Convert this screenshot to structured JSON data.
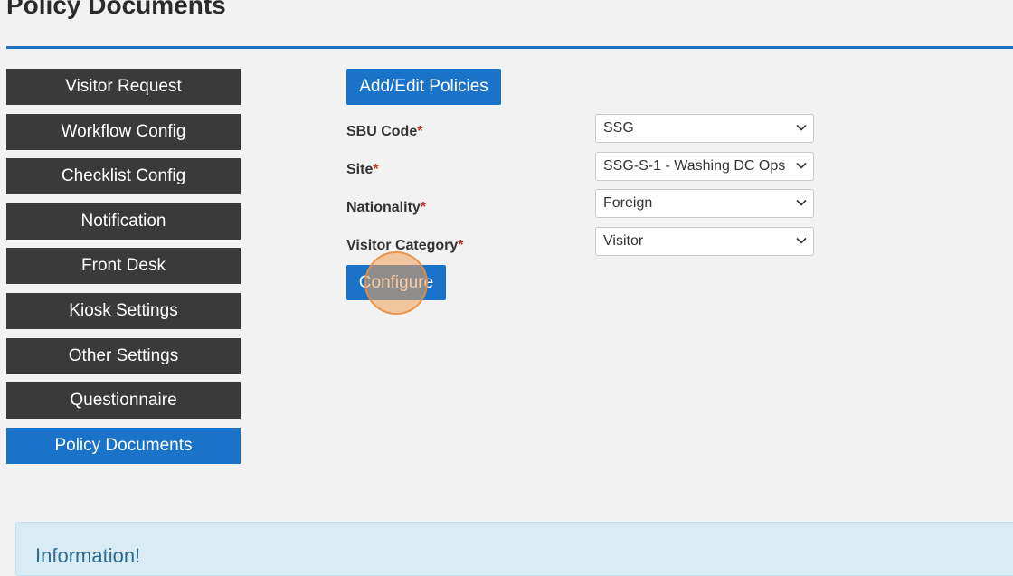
{
  "page": {
    "title": "Policy Documents"
  },
  "colors": {
    "accent": "#1a73c9",
    "sidebar_bg": "#3a3a3a",
    "info_bg": "#d9ecf6",
    "required": "#c0392b",
    "click_marker": "#f0a05a"
  },
  "sidebar": {
    "items": [
      {
        "label": "Visitor Request",
        "active": false
      },
      {
        "label": "Workflow Config",
        "active": false
      },
      {
        "label": "Checklist Config",
        "active": false
      },
      {
        "label": "Notification",
        "active": false
      },
      {
        "label": "Front Desk",
        "active": false
      },
      {
        "label": "Kiosk Settings",
        "active": false
      },
      {
        "label": "Other Settings",
        "active": false
      },
      {
        "label": "Questionnaire",
        "active": false
      },
      {
        "label": "Policy Documents",
        "active": true
      }
    ]
  },
  "main": {
    "add_edit_label": "Add/Edit Policies",
    "configure_label": "Configure",
    "required_mark": "*",
    "fields": {
      "sbu_code": {
        "label": "SBU Code",
        "value": "SSG",
        "icon": "chevron-down-icon"
      },
      "site": {
        "label": "Site",
        "value": "SSG-S-1 - Washing DC Ops",
        "icon": "chevron-down-icon"
      },
      "nationality": {
        "label": "Nationality",
        "value": "Foreign",
        "icon": "chevron-down-icon"
      },
      "visitor_category": {
        "label": "Visitor Category",
        "value": "Visitor",
        "icon": "chevron-down-icon"
      }
    }
  },
  "info": {
    "title": "Information!"
  }
}
